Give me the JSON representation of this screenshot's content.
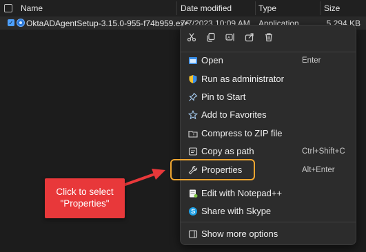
{
  "header": {
    "name": "Name",
    "date_modified": "Date modified",
    "type": "Type",
    "size": "Size"
  },
  "file": {
    "name": "OktaADAgentSetup-3.15.0-955-f74b959.exe",
    "date": "7/7/2023 10:09 AM",
    "type": "Application",
    "size": "5,294 KB",
    "icon": "okta-app-icon"
  },
  "quick_actions": [
    {
      "name": "cut",
      "icon": "scissors-icon"
    },
    {
      "name": "copy",
      "icon": "copy-icon"
    },
    {
      "name": "rename",
      "icon": "rename-icon"
    },
    {
      "name": "share",
      "icon": "share-icon"
    },
    {
      "name": "delete",
      "icon": "trash-icon"
    }
  ],
  "menu": {
    "items": [
      {
        "label": "Open",
        "shortcut": "Enter",
        "icon": "open-window-icon"
      },
      {
        "label": "Run as administrator",
        "shortcut": "",
        "icon": "shield-icon"
      },
      {
        "label": "Pin to Start",
        "shortcut": "",
        "icon": "pin-icon"
      },
      {
        "label": "Add to Favorites",
        "shortcut": "",
        "icon": "star-icon"
      },
      {
        "label": "Compress to ZIP file",
        "shortcut": "",
        "icon": "folder-zip-icon"
      },
      {
        "label": "Copy as path",
        "shortcut": "Ctrl+Shift+C",
        "icon": "copy-path-icon"
      },
      {
        "label": "Properties",
        "shortcut": "Alt+Enter",
        "icon": "wrench-icon"
      },
      {
        "label": "Edit with Notepad++",
        "shortcut": "",
        "icon": "notepad-plus-icon"
      },
      {
        "label": "Share with Skype",
        "shortcut": "",
        "icon": "skype-icon"
      },
      {
        "label": "Show more options",
        "shortcut": "",
        "icon": "more-options-icon"
      }
    ]
  },
  "callout": {
    "line1": "Click to select",
    "line2": "\"Properties\""
  },
  "colors": {
    "background": "#1c1c1c",
    "menu": "#2c2c2c",
    "highlight": "#f0a630",
    "callout": "#e8383a"
  }
}
